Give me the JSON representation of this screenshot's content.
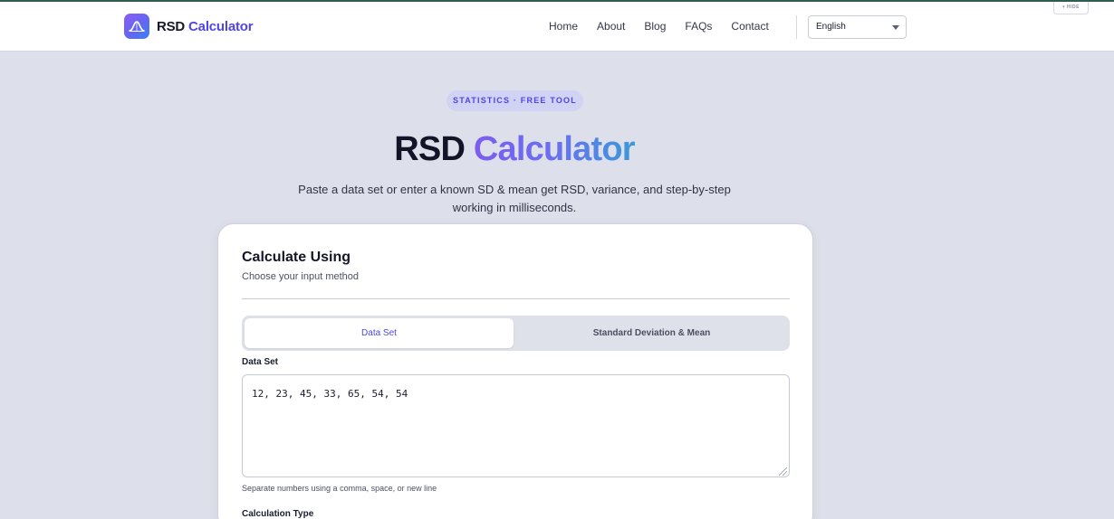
{
  "header": {
    "brand_rsd": "RSD",
    "brand_calc": "Calculator",
    "nav": [
      "Home",
      "About",
      "Blog",
      "FAQs",
      "Contact"
    ],
    "language": "English",
    "hide_label": "▾ HIDE"
  },
  "hero": {
    "pill": "STATISTICS · FREE TOOL",
    "title_part1": "RSD",
    "title_part2": "Calculator",
    "subtitle": "Paste a data set or enter a known SD & mean get RSD, variance, and step-by-step working in milliseconds."
  },
  "card": {
    "title": "Calculate Using",
    "subtitle": "Choose your input method",
    "tabs": [
      "Data Set",
      "Standard Deviation & Mean"
    ],
    "data_set_label": "Data Set",
    "data_set_value": "12, 23, 45, 33, 65, 54, 54",
    "hint": "Separate numbers using a comma, space, or new line",
    "calc_type_label": "Calculation Type"
  },
  "colors": {
    "accent": "#4f46e5",
    "background": "#dde0ea",
    "topline": "#2f5d50"
  },
  "icons": {
    "logo": "bell-curve-icon",
    "language_caret": "chevron-down-icon",
    "textarea_grip": "resize-grip-icon"
  }
}
